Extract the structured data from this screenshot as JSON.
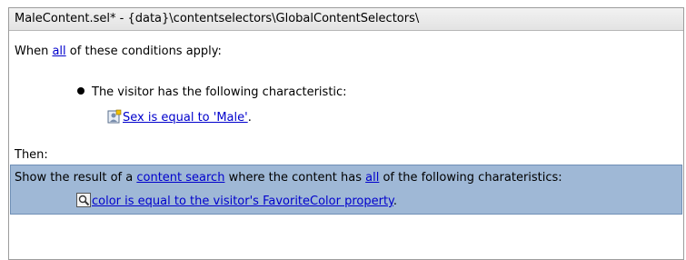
{
  "editor": {
    "title": "MaleContent.sel* - {data}\\contentselectors\\GlobalContentSelectors\\"
  },
  "when": {
    "prefix": "When ",
    "quantifier": "all",
    "suffix": " of these conditions apply:",
    "condition_heading": "The visitor has the following characteristic:",
    "condition_link": "Sex is equal to 'Male'",
    "condition_tail": "."
  },
  "then": {
    "label": "Then:",
    "action_prefix": "Show the result of a ",
    "action_link": "content search",
    "action_middle": " where the content has ",
    "action_quantifier": "all",
    "action_suffix": " of the following charateristics:",
    "criterion_link": "color is equal to the visitor's FavoriteColor property",
    "criterion_tail": "."
  },
  "icons": {
    "condition_icon": "visitor-characteristic-icon",
    "criterion_icon": "content-search-icon"
  }
}
